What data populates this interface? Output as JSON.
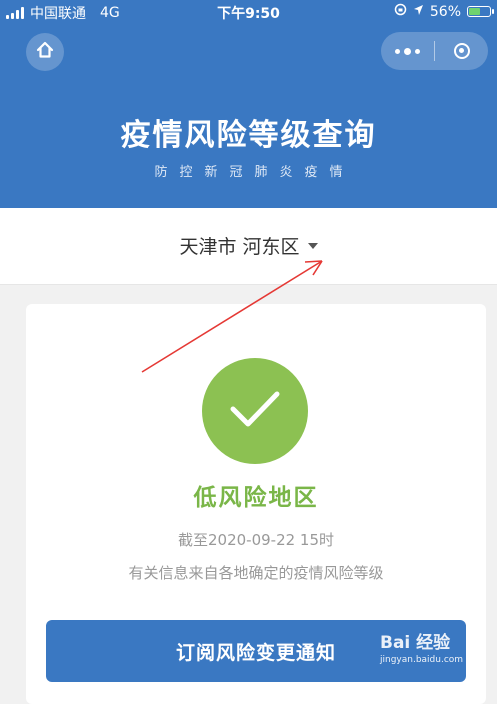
{
  "statusbar": {
    "carrier": "中国联通",
    "network": "4G",
    "time": "下午9:50",
    "battery": "56%",
    "battery_level": 0.56
  },
  "header": {
    "title": "疫情风险等级查询",
    "subtitle": "防控新冠肺炎疫情"
  },
  "region": {
    "label": "天津市 河东区"
  },
  "result": {
    "risk_level": "低风险地区",
    "as_of": "截至2020-09-22 15时",
    "source": "有关信息来自各地确定的疫情风险等级"
  },
  "actions": {
    "subscribe_label": "订阅风险变更通知"
  },
  "watermark": {
    "logo": "Bai 经验",
    "url": "jingyan.baidu.com"
  },
  "colors": {
    "primary": "#3a78c2",
    "success": "#8cc152",
    "success_text": "#7ab648",
    "annotation": "#e53935"
  }
}
